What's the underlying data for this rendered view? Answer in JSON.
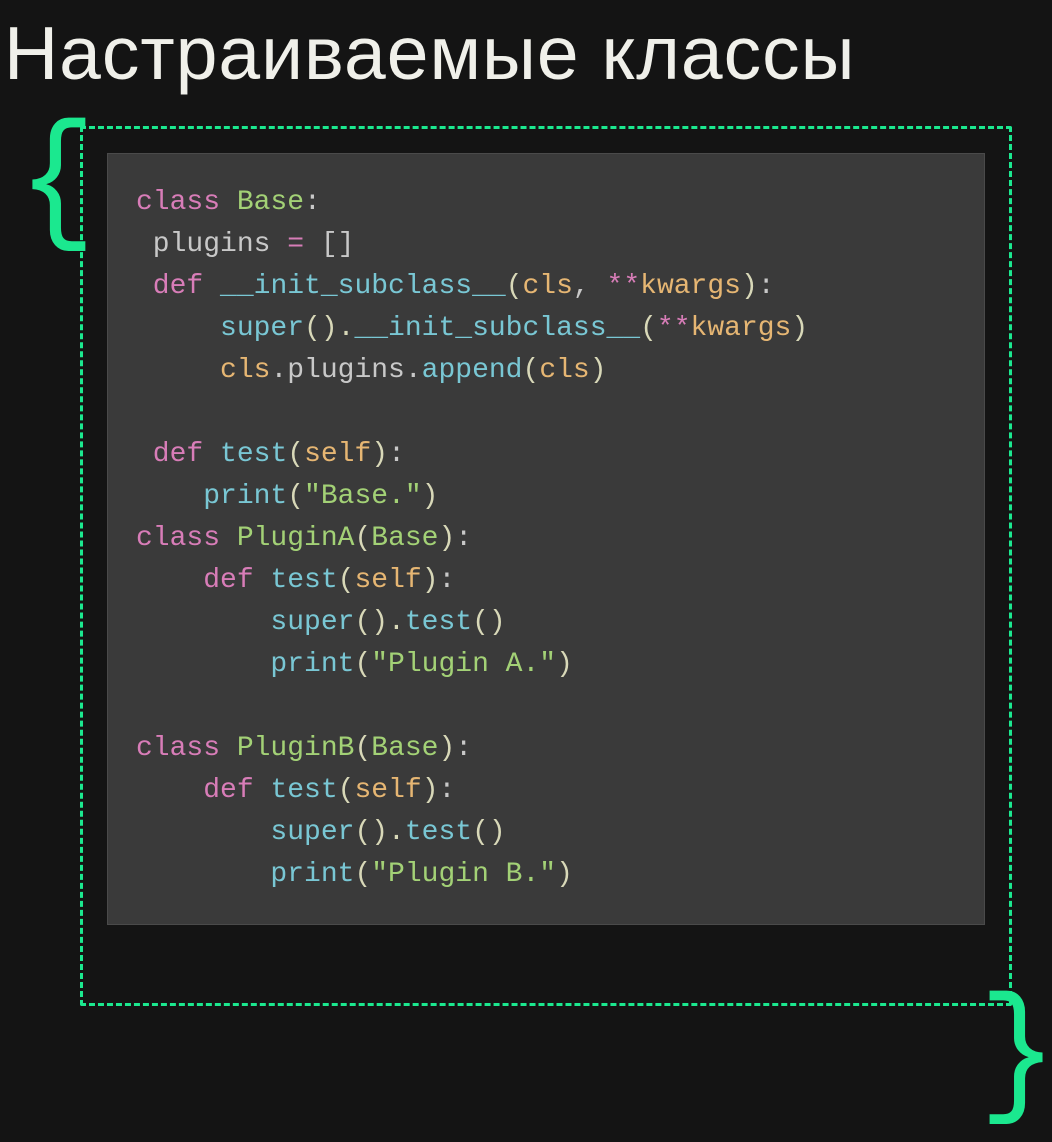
{
  "title": "Настраиваемые классы",
  "braces": {
    "left": "{",
    "right": "}"
  },
  "code": {
    "l1_class": "class",
    "l1_name": "Base",
    "l1_colon": ":",
    "l2_attr": " plugins ",
    "l2_op": "=",
    "l2_val": " []",
    "l3_def": " def",
    "l3_fn": "__init_subclass__",
    "l3_p1": "cls",
    "l3_comma": ", ",
    "l3_stars": "**",
    "l3_p2": "kwargs",
    "l4_super": "super",
    "l4_call": "().",
    "l4_fn": "__init_subclass__",
    "l4_stars": "**",
    "l4_arg": "kwargs",
    "l5_cls": "cls",
    "l5_attr": ".plugins.",
    "l5_fn": "append",
    "l5_arg": "cls",
    "l7_def": " def",
    "l7_fn": "test",
    "l7_self": "self",
    "l8_print": "print",
    "l8_str": "\"Base.\"",
    "l9_class": "class",
    "l9_name": "PluginA",
    "l9_base": "Base",
    "l10_def": "def",
    "l10_fn": "test",
    "l10_self": "self",
    "l11_super": "super",
    "l11_call": "().",
    "l11_fn": "test",
    "l11_args": "()",
    "l12_print": "print",
    "l12_str": "\"Plugin A.\"",
    "l14_class": "class",
    "l14_name": "PluginB",
    "l14_base": "Base",
    "l15_def": "def",
    "l15_fn": "test",
    "l15_self": "self",
    "l16_super": "super",
    "l16_call": "().",
    "l16_fn": "test",
    "l16_args": "()",
    "l17_print": "print",
    "l17_str": "\"Plugin B.\""
  }
}
